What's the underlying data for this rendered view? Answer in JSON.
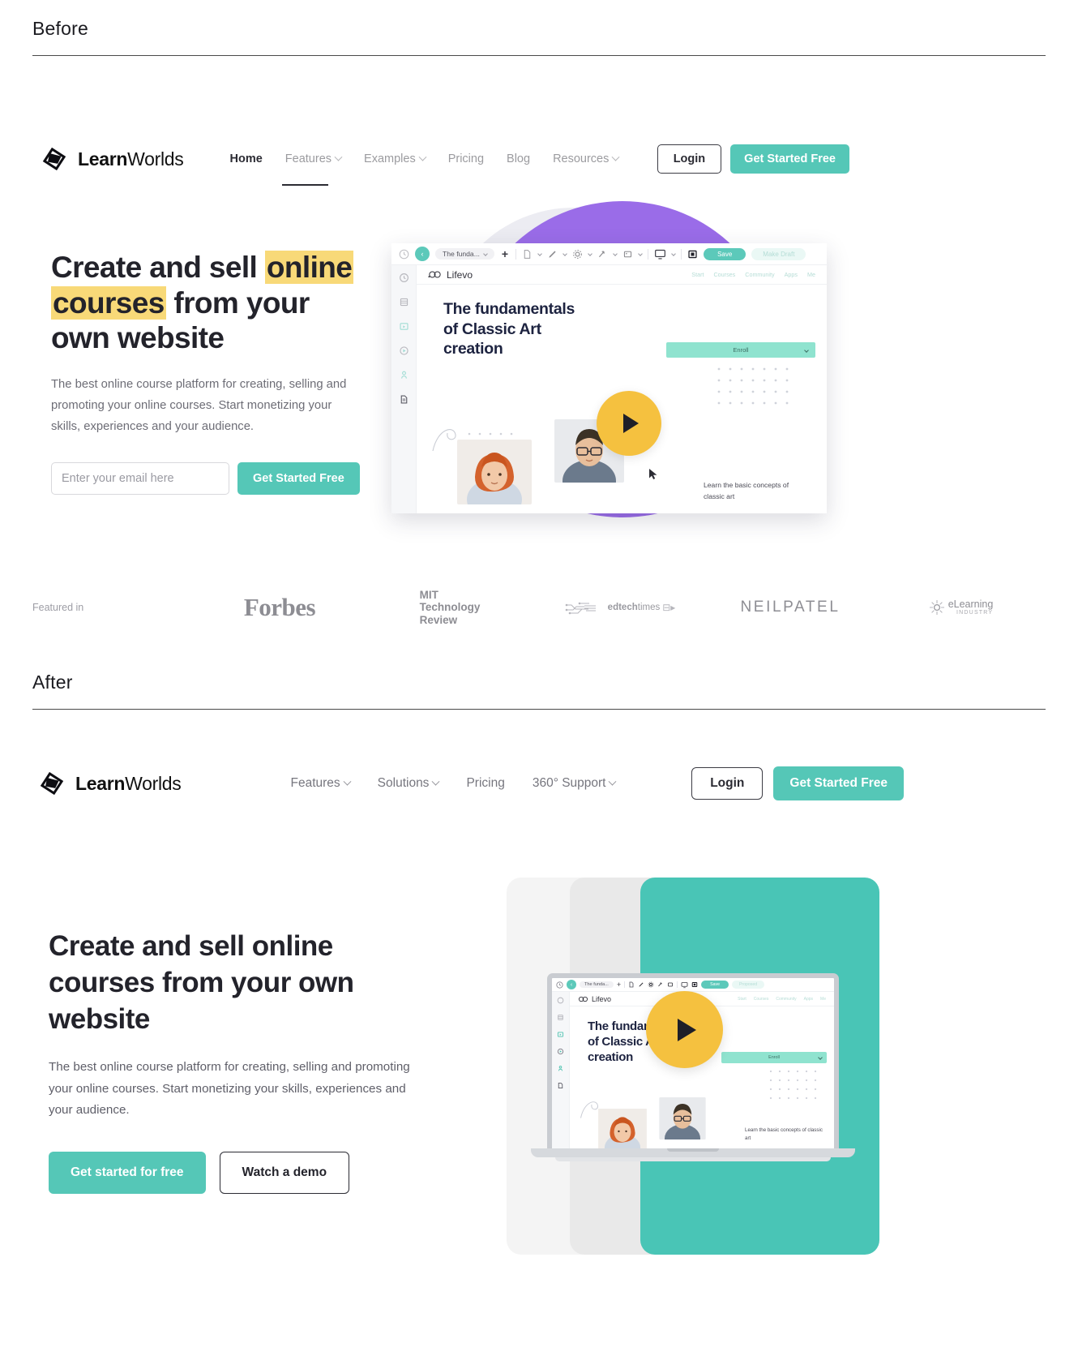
{
  "sections": {
    "before_label": "Before",
    "after_label": "After"
  },
  "brand": {
    "name_bold": "Learn",
    "name_light": "Worlds",
    "logo_icon": "learnworlds-logo-icon",
    "teal": "#55c7b7",
    "highlight_yellow": "#f8d978",
    "purple": "#9a6ce8"
  },
  "before": {
    "nav": {
      "links": [
        {
          "label": "Home",
          "has_caret": false,
          "active": true
        },
        {
          "label": "Features",
          "has_caret": true,
          "active": false
        },
        {
          "label": "Examples",
          "has_caret": true,
          "active": false
        },
        {
          "label": "Pricing",
          "has_caret": false,
          "active": false
        },
        {
          "label": "Blog",
          "has_caret": false,
          "active": false
        },
        {
          "label": "Resources",
          "has_caret": true,
          "active": false
        }
      ],
      "login_label": "Login",
      "cta_label": "Get Started Free"
    },
    "hero": {
      "headline_part1": "Create and sell ",
      "headline_hl1": "online",
      "headline_part2": " ",
      "headline_hl2": "courses",
      "headline_part3": " from your own website",
      "paragraph": "The best online course platform for creating, selling and promoting your online courses. Start monetizing your skills, experiences and your audience.",
      "email_placeholder": "Enter your email here",
      "email_value": "",
      "cta_label": "Get Started Free"
    },
    "product_mock": {
      "toolbar": {
        "back_icon": "back-arrow-icon",
        "history_icon": "history-clock-icon",
        "page_title": "The funda...",
        "add_icon": "plus-icon",
        "tools": [
          "file-icon",
          "pencil-icon",
          "settings-gear-icon",
          "link-icon",
          "image-icon"
        ],
        "device_icon": "desktop-preview-icon",
        "grid_icon": "layout-grid-icon",
        "save_label": "Save",
        "draft_label": "Make Draft"
      },
      "site": {
        "logo_icon": "lifevo-logo-icon",
        "site_name": "Lifevo",
        "links": [
          "Start",
          "Courses",
          "Community",
          "Apps",
          "Me"
        ]
      },
      "course_title_line1": "The fundamentals",
      "course_title_line2": "of Classic Art",
      "course_title_line3": "creation",
      "enroll_label": "Enroll",
      "play_icon": "play-button-icon",
      "learn_text": "Learn the basic concepts of classic art",
      "rail_icons": [
        "history-clock-icon",
        "pages-icon",
        "media-icon",
        "video-icon",
        "user-icon",
        "document-icon"
      ]
    },
    "featured": {
      "label": "Featured in",
      "logos": [
        {
          "name": "forbes-logo",
          "text": "Forbes"
        },
        {
          "name": "mit-technology-review-logo",
          "line1": "MIT",
          "line2": "Technology",
          "line3": "Review"
        },
        {
          "name": "edtechtimes-logo",
          "text_bold": "edtech",
          "text_light": "times"
        },
        {
          "name": "neilpatel-logo",
          "text": "NEILPATEL"
        },
        {
          "name": "elearning-industry-logo",
          "text_top": "eLearning",
          "text_bottom": "INDUSTRY"
        }
      ]
    }
  },
  "after": {
    "nav": {
      "links": [
        {
          "label": "Features",
          "has_caret": true
        },
        {
          "label": "Solutions",
          "has_caret": true
        },
        {
          "label": "Pricing",
          "has_caret": false
        },
        {
          "label": "360° Support",
          "has_caret": true
        }
      ],
      "login_label": "Login",
      "cta_label": "Get Started Free"
    },
    "hero": {
      "headline": "Create and sell online courses from your own website",
      "paragraph": "The best online course platform for creating, selling and promoting your online courses. Start monetizing your skills, experiences and your audience.",
      "primary_cta": "Get started for free",
      "secondary_cta": "Watch a demo"
    },
    "laptop_mock": {
      "toolbar": {
        "page_title": "The funda...",
        "save_label": "Save",
        "draft_label": "Proposed"
      },
      "site_name": "Lifevo",
      "links": [
        "Start",
        "Courses",
        "Community",
        "Apps",
        "Me"
      ],
      "course_title_line1": "The fundame",
      "course_title_line2": "of Classic A",
      "course_title_line3": "creation",
      "enroll_label": "Enroll",
      "play_icon": "play-button-icon",
      "learn_text": "Learn the basic concepts of classic art"
    }
  }
}
